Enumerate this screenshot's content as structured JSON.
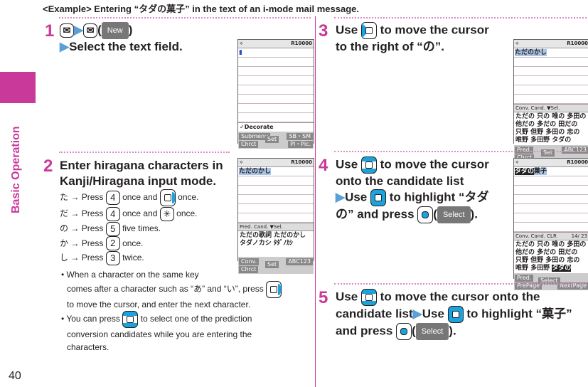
{
  "section": {
    "label": "Basic Operation",
    "accent": "#c9399a"
  },
  "page_number": "40",
  "example_heading": "<Example> Entering “タダの菓子” in the text of an i-mode mail message.",
  "steps": [
    {
      "num": "1",
      "line1_close": ")",
      "new_key": "New",
      "line2": "Select the text field."
    },
    {
      "num": "2",
      "line1": "Enter hiragana characters in",
      "line2": "Kanji/Hiragana input mode.",
      "key_presses": [
        {
          "char": "た",
          "arrow": "→ Press",
          "key": "4",
          "mid": "once and",
          "key2_type": "right",
          "tail": "once."
        },
        {
          "char": "だ",
          "arrow": "→ Press",
          "key": "4",
          "mid": "once and",
          "key2": "✳",
          "tail": "once."
        },
        {
          "char": "の",
          "arrow": "→ Press",
          "key": "5",
          "tail": "five times."
        },
        {
          "char": "か",
          "arrow": "→ Press",
          "key": "2",
          "tail": "once."
        },
        {
          "char": "し",
          "arrow": "→ Press",
          "key": "3",
          "tail": "twice."
        }
      ],
      "notes": [
        {
          "a": "• When a character on the same key",
          "b": "comes after a character such as “あ” and “い”, press",
          "c": "to move the cursor, and enter the next character."
        },
        {
          "a": "• You can press",
          "b": "to select one of the prediction",
          "c": "conversion candidates while you are entering the",
          "d": "characters."
        }
      ]
    },
    {
      "num": "3",
      "use": "Use",
      "line1": "to move the cursor",
      "line2": "to the right of “の”."
    },
    {
      "num": "4",
      "use": "Use",
      "line1": "to move the cursor",
      "line2": "onto the candidate list",
      "line3a": "Use",
      "line3b": "to highlight “タダ",
      "line4a": "の” and press",
      "select_key": "Select",
      "close": ")."
    },
    {
      "num": "5",
      "use": "Use",
      "line1": "to move the cursor onto the",
      "line2a": "candidate list",
      "line2b": "Use",
      "line2c": "to highlight “菓子”",
      "line3a": "and press",
      "select_key": "Select",
      "close": ")."
    }
  ],
  "screens": {
    "s1": {
      "mem": "R10000",
      "deco": "Decorate",
      "soft": [
        "Submenu",
        "Set",
        "SB・SM",
        "Chrct",
        "Pl・Pic."
      ]
    },
    "s2": {
      "mem": "R10000",
      "text": "ただのかし",
      "bar": "Pred. Cand.  ▼Sel.",
      "cands": [
        "ただの歌詞 ただのかし",
        "タダノカシ ﾀﾀﾞﾉｶｼ"
      ],
      "soft": [
        "Conv.",
        "Set",
        "ABC123",
        "Chrct"
      ]
    },
    "s3": {
      "mem": "R10000",
      "text": "ただのかし",
      "bar": "Conv. Cand.  ▼Sel.",
      "cands": [
        "ただの 只の 唯の 多田の",
        "他だの 多だの 田だの",
        "只野 但野 多田の 忠の",
        "唯野 多田野 タダの"
      ],
      "soft": [
        "Pred.",
        "Set",
        "ABC123",
        "Chrct"
      ]
    },
    "s4": {
      "mem": "R10000",
      "text_a": "タダの",
      "text_b": "菓子",
      "bar": "Conv. Cand.  CLR",
      "count": "14/ 23",
      "cands": [
        "ただの 只の 唯の 多田の",
        "他だの 多だの 田だの",
        "只野 但野 多田の 忠の",
        "唯野 多田野"
      ],
      "selected": "タダの",
      "soft": [
        "Pred.",
        "Select",
        "PrePage",
        "NextPage"
      ]
    }
  }
}
